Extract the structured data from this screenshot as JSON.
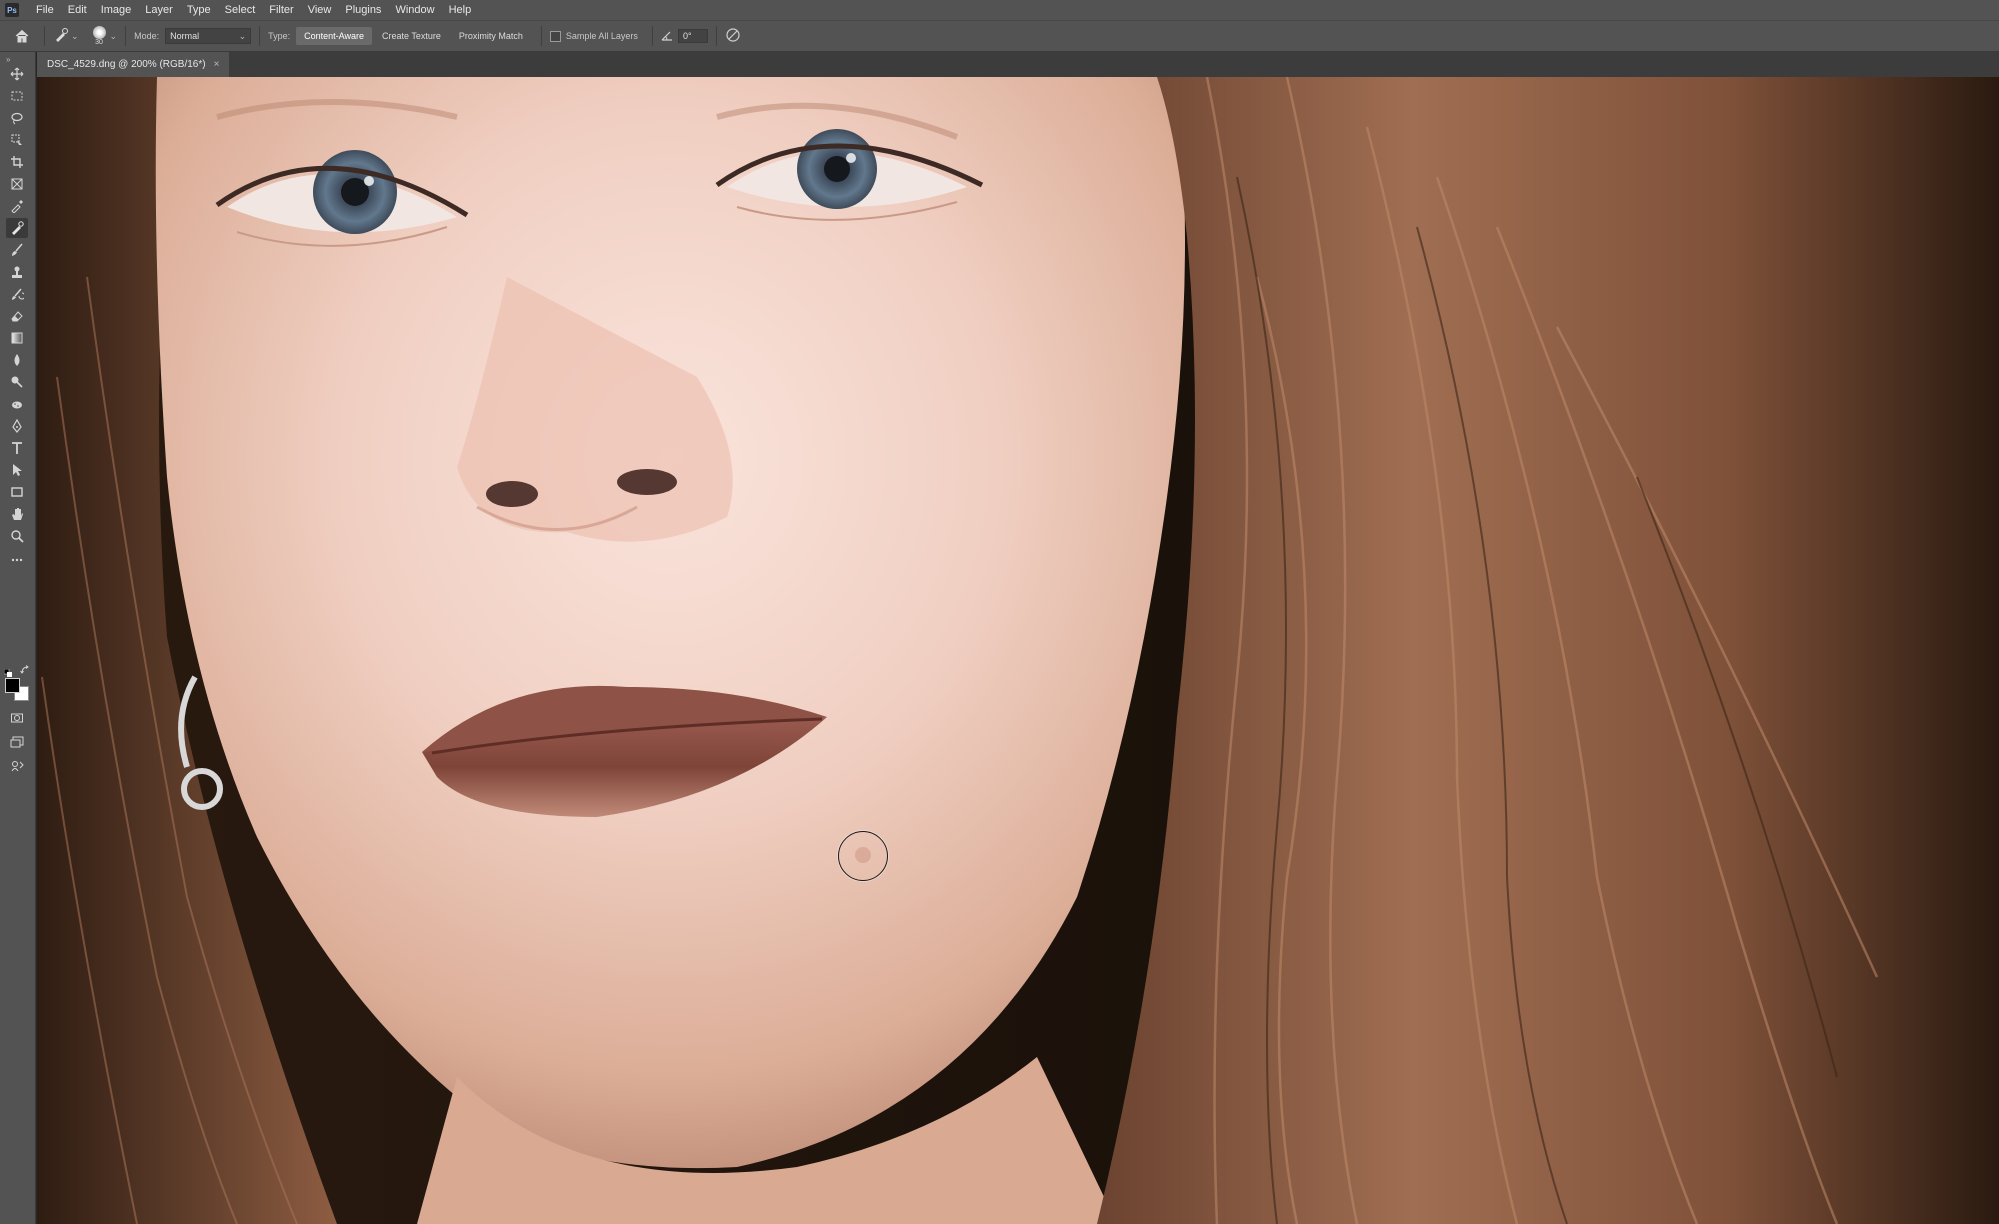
{
  "app": {
    "logo_text": "Ps"
  },
  "menu": [
    "File",
    "Edit",
    "Image",
    "Layer",
    "Type",
    "Select",
    "Filter",
    "View",
    "Plugins",
    "Window",
    "Help"
  ],
  "options_bar": {
    "brush_size": "30",
    "mode_label": "Mode:",
    "mode_value": "Normal",
    "type_label": "Type:",
    "type_options": [
      "Content-Aware",
      "Create Texture",
      "Proximity Match"
    ],
    "type_selected": "Content-Aware",
    "sample_all_layers_label": "Sample All Layers",
    "sample_all_layers_checked": false,
    "angle_value": "0°"
  },
  "document": {
    "tab_title": "DSC_4529.dng @ 200% (RGB/16*)",
    "tab_close": "×"
  },
  "tools": {
    "active": "spot-healing-brush",
    "foreground_color": "#000000",
    "background_color": "#ffffff"
  },
  "colors": {
    "chrome": "#535353",
    "canvas_background": "#1c140e",
    "skin": "#f0cfc2",
    "hair": "#8a5a40",
    "lips": "#a7655a",
    "eyes": "#5c6f82"
  }
}
